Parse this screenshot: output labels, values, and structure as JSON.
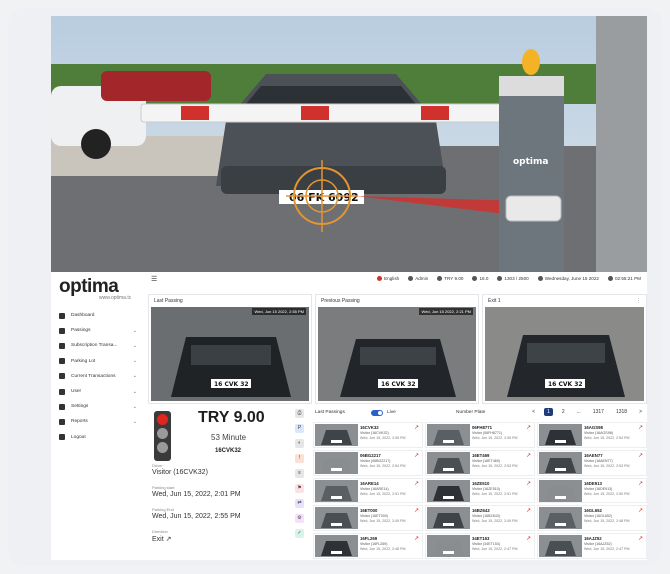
{
  "brand": {
    "name": "optima",
    "url": "www.optima.tc"
  },
  "hero": {
    "camera_label": "optima",
    "hero_plate": "06 FK 6092"
  },
  "topbar": {
    "language": "English",
    "user": "Admin",
    "try": "TRY 9.00",
    "count1": "16.0",
    "count2": "1303 / 2500",
    "date": "Wednesday, June 15 2022",
    "time": "02:55:21 PM"
  },
  "menu": [
    {
      "label": "Dashboard",
      "icon": "home-icon",
      "chevron": false
    },
    {
      "label": "Passings",
      "icon": "passing-icon",
      "chevron": true
    },
    {
      "label": "Subscription Transa...",
      "icon": "user-icon",
      "chevron": true
    },
    {
      "label": "Parking Lot",
      "icon": "car-icon",
      "chevron": true
    },
    {
      "label": "Current Transactions",
      "icon": "list-icon",
      "chevron": true
    },
    {
      "label": "User",
      "icon": "users-icon",
      "chevron": true
    },
    {
      "label": "Settings",
      "icon": "settings-icon",
      "chevron": true
    },
    {
      "label": "Reports",
      "icon": "reports-icon",
      "chevron": true
    },
    {
      "label": "Logout",
      "icon": "logout-icon",
      "chevron": false
    }
  ],
  "panels": {
    "last": {
      "title": "Last Passing",
      "timestamp": "Wed, Jun 15 2022, 2:55 PM",
      "plate": "16 CVK 32"
    },
    "previous": {
      "title": "Previous Passing",
      "timestamp": "Wed, Jun 15 2022, 2:21 PM",
      "plate": "16 CVK 32"
    },
    "exit": {
      "title": "Exit 1",
      "plate": "16 CVK 32"
    }
  },
  "card": {
    "price": "TRY 9.00",
    "duration": "53 Minute",
    "plate": "16CVK32",
    "driver_label": "Driver",
    "driver_value": "Visitor (16CVK32)",
    "entry_label": "Parking start",
    "entry_value": "Wed, Jun 15, 2022, 2:01 PM",
    "exit_label": "Parking End",
    "exit_value": "Wed, Jun 15, 2022, 2:55 PM",
    "direction_label": "Direction",
    "direction_value": "Exit ↗"
  },
  "list": {
    "title": "Last Passings",
    "toggle_label": "Live",
    "filter_label": "Number Plate",
    "pages": [
      "<",
      "1",
      "2",
      "...",
      "1317",
      "1318",
      ">"
    ],
    "active_page": "1",
    "entries": [
      {
        "plate": "16CVK32",
        "name": "Visitor (16CVK32)",
        "time": "Wed, Jun 15, 2022, 2:55 PM"
      },
      {
        "plate": "06FH8771",
        "name": "Visitor (06FH8771)",
        "time": "Wed, Jun 15, 2022, 2:55 PM"
      },
      {
        "plate": "16AGS98",
        "name": "Visitor (16AGS98)",
        "time": "Wed, Jun 15, 2022, 2:54 PM"
      },
      {
        "plate": "06BG2217",
        "name": "Visitor (06BG2217)",
        "time": "Wed, Jun 15, 2022, 2:54 PM"
      },
      {
        "plate": "16ET469",
        "name": "Visitor (16ET469)",
        "time": "Wed, Jun 15, 2022, 2:53 PM"
      },
      {
        "plate": "16AEN77",
        "name": "Visitor (16AEN77)",
        "time": "Wed, Jun 15, 2022, 2:53 PM"
      },
      {
        "plate": "16ARE14",
        "name": "Visitor (16ARE14)",
        "time": "Wed, Jun 15, 2022, 2:51 PM"
      },
      {
        "plate": "16ZE510",
        "name": "Visitor (16ZE510)",
        "time": "Wed, Jun 15, 2022, 2:51 PM"
      },
      {
        "plate": "16DE913",
        "name": "Visitor (16DE913)",
        "time": "Wed, Jun 15, 2022, 2:50 PM"
      },
      {
        "plate": "16ET000",
        "name": "Visitor (16ET000)",
        "time": "Wed, Jun 15, 2022, 2:49 PM"
      },
      {
        "plate": "16BZ643",
        "name": "Visitor (16BZ643)",
        "time": "Wed, Jun 15, 2022, 2:49 PM"
      },
      {
        "plate": "16GL652",
        "name": "Visitor (16GL652)",
        "time": "Wed, Jun 15, 2022, 2:48 PM"
      },
      {
        "plate": "16FL269",
        "name": "Visitor (16FL269)",
        "time": "Wed, Jun 15, 2022, 2:48 PM"
      },
      {
        "plate": "34ET153",
        "name": "Visitor (34ET153)",
        "time": "Wed, Jun 15, 2022, 2:47 PM"
      },
      {
        "plate": "16AJZ52",
        "name": "Visitor (16AJZ52)",
        "time": "Wed, Jun 15, 2022, 2:47 PM"
      }
    ]
  },
  "colors": {
    "accent": "#d0312d",
    "nav_active": "#1f3c7a",
    "toggle": "#2b62c9"
  }
}
